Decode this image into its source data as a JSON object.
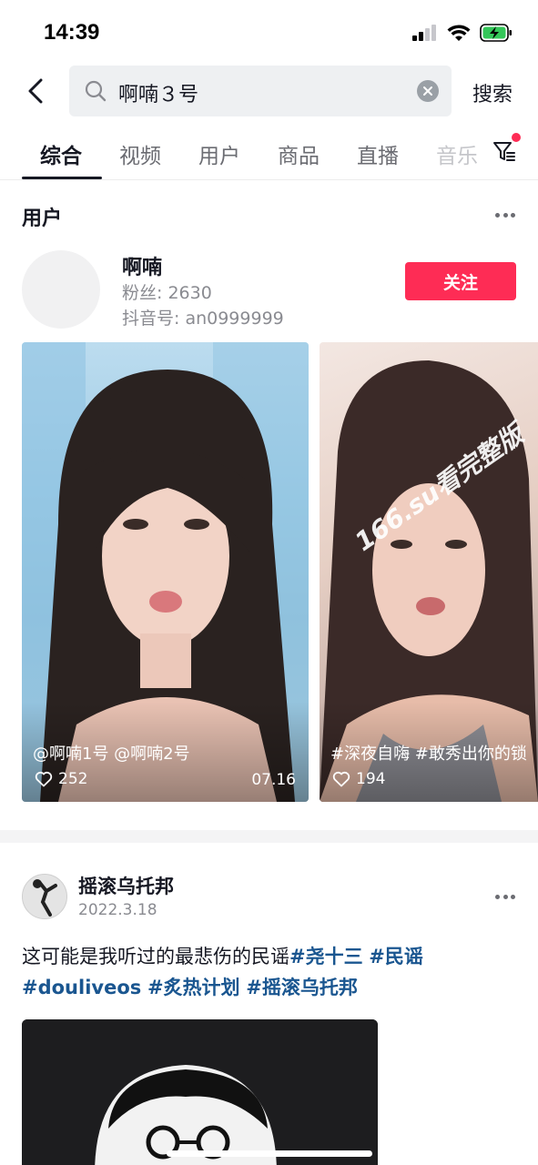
{
  "status_bar": {
    "time": "14:39"
  },
  "search": {
    "query": "啊喃３号",
    "submit_label": "搜索"
  },
  "tabs": [
    {
      "label": "综合"
    },
    {
      "label": "视频"
    },
    {
      "label": "用户"
    },
    {
      "label": "商品"
    },
    {
      "label": "直播"
    },
    {
      "label": "音乐"
    }
  ],
  "users_section": {
    "title": "用户",
    "user": {
      "name": "啊喃",
      "fans": "粉丝: 2630",
      "douyin_id": "抖音号: an0999999",
      "follow_label": "关注"
    }
  },
  "videos": [
    {
      "caption": "@啊喃1号 @啊喃2号",
      "likes": "252",
      "date": "07.16"
    },
    {
      "caption": "#深夜自嗨 #敢秀出你的锁",
      "likes": "194",
      "watermark": "166.su看完整版"
    }
  ],
  "post": {
    "author": "摇滚乌托邦",
    "date": "2022.3.18",
    "text_plain": "这可能是我听过的最悲伤的民谣",
    "hashtags": [
      "#尧十三",
      "#民谣",
      "#douliveos",
      "#炙热计划",
      "#摇滚乌托邦"
    ]
  },
  "colors": {
    "accent": "#fe2c55",
    "hashtag": "#1a5690",
    "battery": "#34c759"
  }
}
